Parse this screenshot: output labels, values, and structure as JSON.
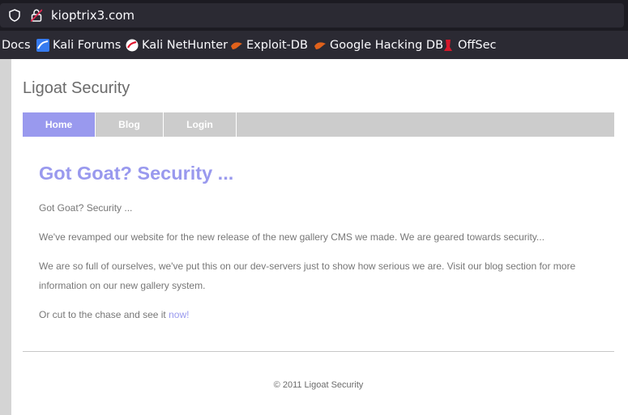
{
  "browser": {
    "url": "kioptrix3.com",
    "bookmarks": [
      {
        "label": "Docs",
        "icon": "none"
      },
      {
        "label": "Kali Forums",
        "icon": "kali-forums-icon"
      },
      {
        "label": "Kali NetHunter",
        "icon": "kali-nethunter-icon"
      },
      {
        "label": "Exploit-DB",
        "icon": "exploit-db-icon"
      },
      {
        "label": "Google Hacking DB",
        "icon": "google-hacking-db-icon"
      },
      {
        "label": "OffSec",
        "icon": "offsec-icon"
      }
    ]
  },
  "site": {
    "title": "Ligoat Security",
    "nav": [
      {
        "label": "Home",
        "active": true
      },
      {
        "label": "Blog",
        "active": false
      },
      {
        "label": "Login",
        "active": false
      }
    ],
    "heading": "Got Goat? Security ...",
    "paragraphs": [
      "Got Goat? Security ...",
      "We've revamped our website for the new release of the new gallery CMS we made. We are geared towards security...",
      "We are so full of ourselves, we've put this on our dev-servers just to show how serious we are. Visit our blog section for more information on our new gallery system."
    ],
    "cta_prefix": "Or cut to the chase and see it ",
    "cta_link": "now!",
    "footer": "© 2011 Ligoat Security"
  },
  "colors": {
    "accent": "#9999ee",
    "nav_bg": "#cccccc",
    "chrome_bg": "#2b2a33",
    "text": "#777777"
  }
}
